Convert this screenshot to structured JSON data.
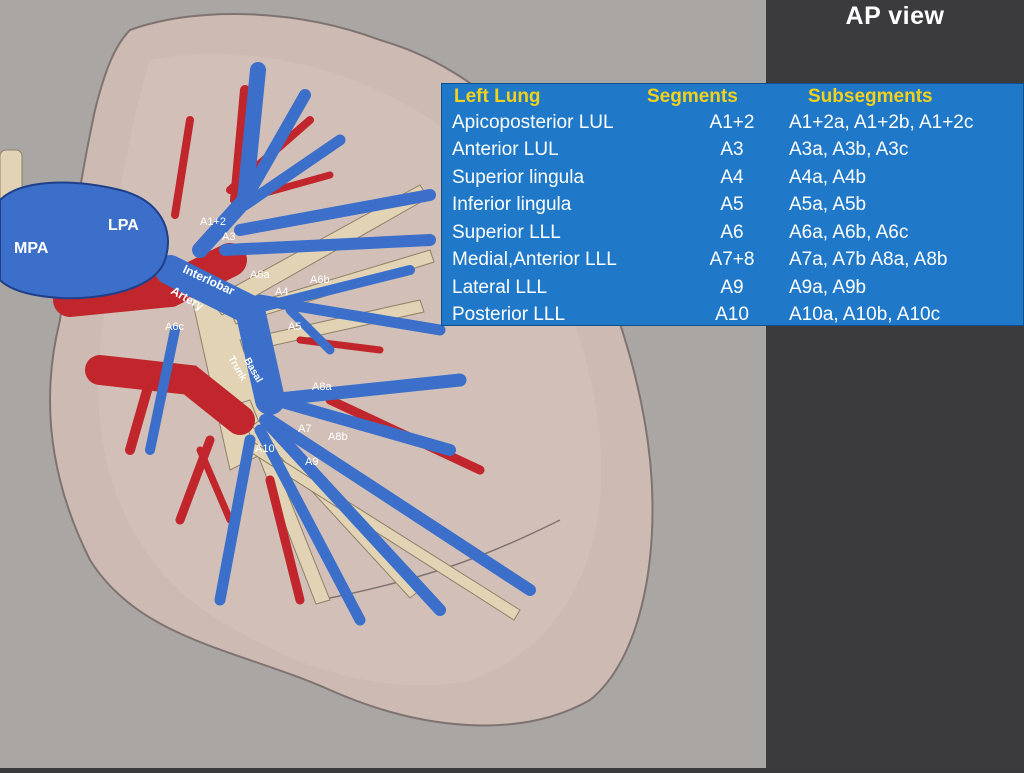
{
  "view_title": "AP view",
  "table": {
    "headers": {
      "lung": "Left Lung",
      "segments": "Segments",
      "subsegments": "Subsegments"
    },
    "rows": [
      {
        "name": "Apicoposterior LUL",
        "segment": "A1+2",
        "subsegments": "A1+2a, A1+2b, A1+2c"
      },
      {
        "name": "Anterior LUL",
        "segment": "A3",
        "subsegments": "A3a, A3b, A3c"
      },
      {
        "name": "Superior lingula",
        "segment": "A4",
        "subsegments": "A4a, A4b"
      },
      {
        "name": "Inferior lingula",
        "segment": "A5",
        "subsegments": "A5a, A5b"
      },
      {
        "name": "Superior LLL",
        "segment": "A6",
        "subsegments": "A6a, A6b, A6c"
      },
      {
        "name": "Medial,Anterior LLL",
        "segment": "A7+8",
        "subsegments": "A7a, A7b A8a, A8b"
      },
      {
        "name": "Lateral LLL",
        "segment": "A9",
        "subsegments": "A9a, A9b"
      },
      {
        "name": "Posterior LLL",
        "segment": "A10",
        "subsegments": "A10a, A10b, A10c"
      }
    ]
  },
  "labels": {
    "mpa": "MPA",
    "lpa": "LPA",
    "interlobar": "Interlobar",
    "artery": "Artery",
    "basal": "Basal",
    "trunk": "Trunk"
  },
  "small_labels": [
    "A1+2",
    "A3",
    "A6a",
    "A4",
    "A6b",
    "A6c",
    "A5",
    "A8a",
    "A7",
    "A8b",
    "A10",
    "A9"
  ],
  "colors": {
    "artery_blue": "#3b6fc9",
    "vein_red": "#c0262b",
    "table_bg": "#1f78c8",
    "header_yellow": "#f2d21a",
    "background_gray": "#a9a6a4",
    "panel_dark": "#3b3b3d"
  }
}
